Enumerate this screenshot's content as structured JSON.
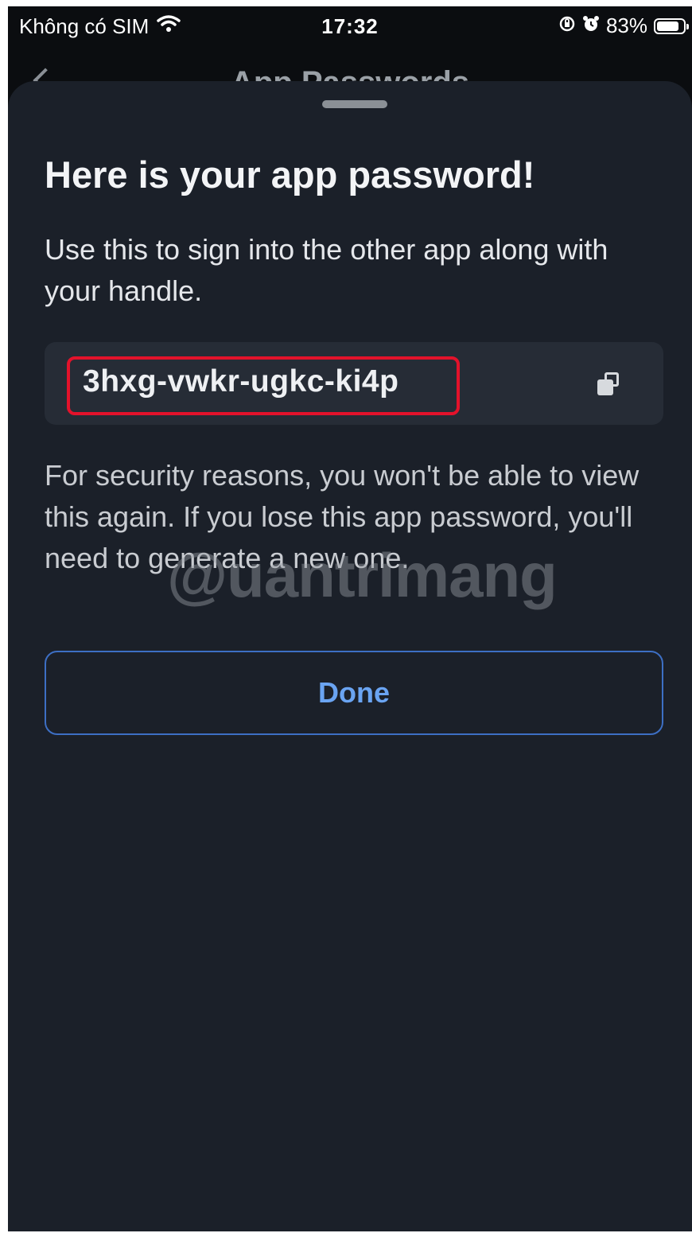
{
  "status_bar": {
    "carrier": "Không có SIM",
    "wifi_icon": "wifi-icon",
    "time": "17:32",
    "lock_rotation_icon": "rotation-lock-icon",
    "alarm_icon": "alarm-icon",
    "battery_percent": "83%",
    "battery_level": 0.83
  },
  "background_nav": {
    "back_icon": "chevron-left-icon",
    "title": "App Passwords"
  },
  "sheet": {
    "title": "Here is your app password!",
    "description": "Use this to sign into the other app along with your handle.",
    "password": "3hxg-vwkr-ugkc-ki4p",
    "copy_icon": "copy-icon",
    "security_note": "For security reasons, you won't be able to view this again. If you lose this app password, you'll need to generate a new one.",
    "done_label": "Done"
  },
  "watermark": "@uantrimang",
  "colors": {
    "sheet_bg": "#1b2029",
    "accent": "#6aa4f2",
    "highlight": "#e3122b"
  }
}
